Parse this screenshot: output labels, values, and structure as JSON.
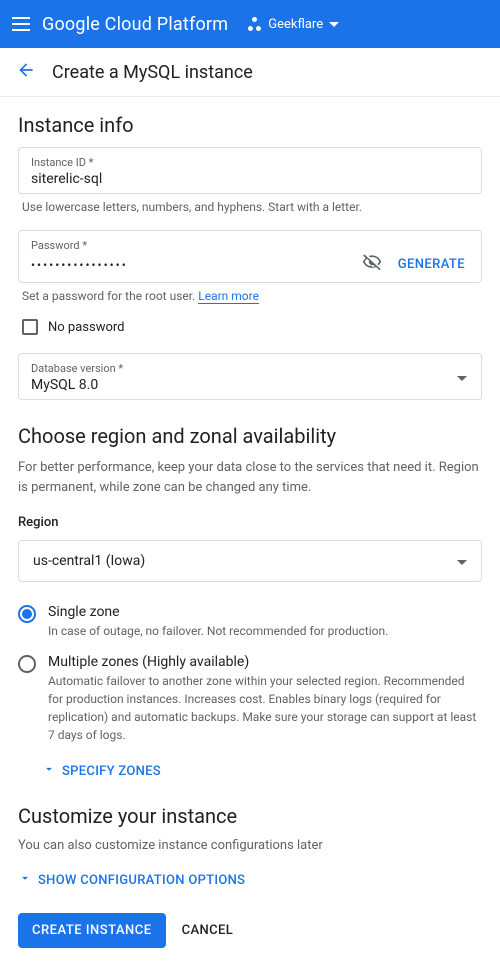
{
  "header": {
    "product": "Google Cloud Platform",
    "project": "Geekflare"
  },
  "page": {
    "title": "Create a MySQL instance"
  },
  "instance_info": {
    "heading": "Instance info",
    "id_label": "Instance ID *",
    "id_value": "siterelic-sql",
    "id_helper": "Use lowercase letters, numbers, and hyphens. Start with a letter.",
    "password_label": "Password *",
    "password_value": "••••••••••••••••",
    "generate_label": "GENERATE",
    "password_helper_pre": "Set a password for the root user. ",
    "password_helper_link": "Learn more",
    "no_password_label": "No password",
    "version_label": "Database version *",
    "version_value": "MySQL 8.0"
  },
  "region": {
    "heading": "Choose region and zonal availability",
    "desc": "For better performance, keep your data close to the services that need it. Region is permanent, while zone can be changed any time.",
    "label": "Region",
    "value": "us-central1 (Iowa)",
    "single_label": "Single zone",
    "single_desc": "In case of outage, no failover. Not recommended for production.",
    "multi_label": "Multiple zones (Highly available)",
    "multi_desc": "Automatic failover to another zone within your selected region. Recommended for production instances. Increases cost. Enables binary logs (required for replication) and automatic backups. Make sure your storage can support at least 7 days of logs.",
    "specify_zones": "SPECIFY ZONES"
  },
  "customize": {
    "heading": "Customize your instance",
    "desc": "You can also customize instance configurations later",
    "show_config": "SHOW CONFIGURATION OPTIONS"
  },
  "actions": {
    "create": "CREATE INSTANCE",
    "cancel": "CANCEL"
  }
}
